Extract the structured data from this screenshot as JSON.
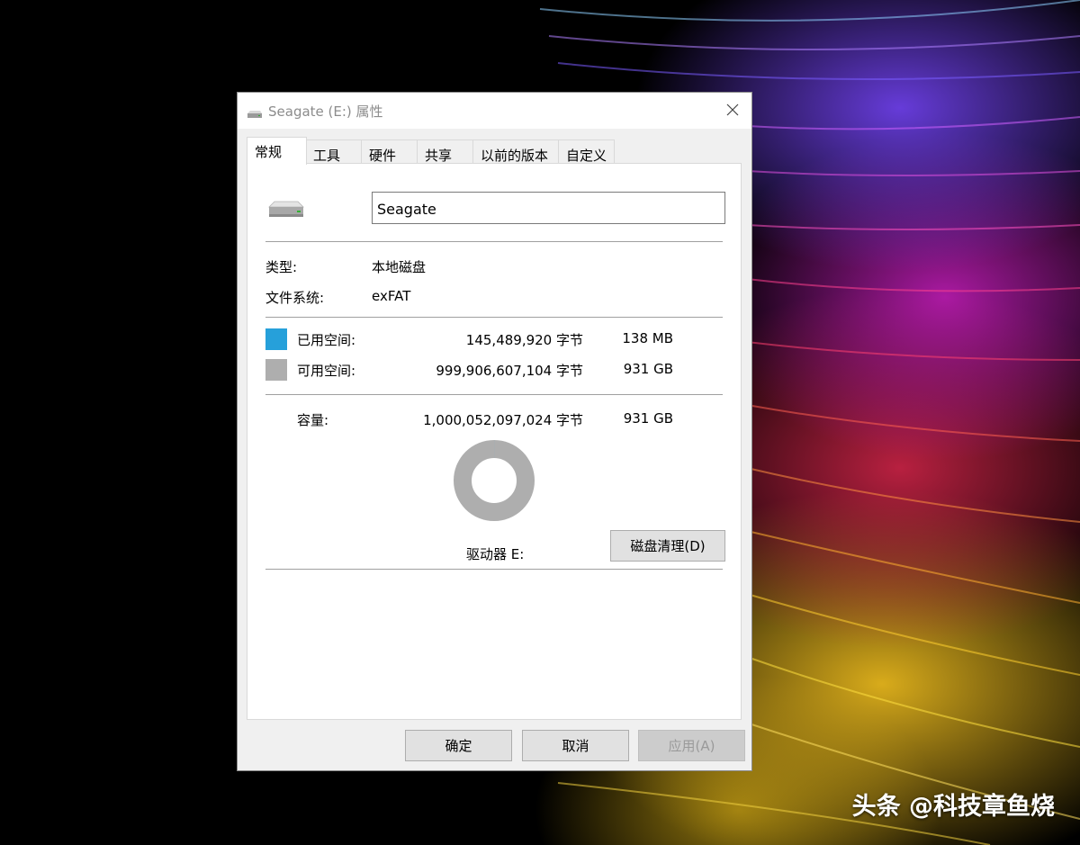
{
  "window": {
    "title": "Seagate (E:) 属性"
  },
  "tabs": [
    {
      "label": "常规",
      "active": true
    },
    {
      "label": "工具"
    },
    {
      "label": "硬件"
    },
    {
      "label": "共享"
    },
    {
      "label": "以前的版本"
    },
    {
      "label": "自定义"
    }
  ],
  "general": {
    "volume_name": "Seagate",
    "type_label": "类型:",
    "type_value": "本地磁盘",
    "fs_label": "文件系统:",
    "fs_value": "exFAT",
    "used": {
      "label": "已用空间:",
      "bytes": "145,489,920 字节",
      "size": "138 MB",
      "color": "#26a0da"
    },
    "free": {
      "label": "可用空间:",
      "bytes": "999,906,607,104 字节",
      "size": "931 GB",
      "color": "#aeaeae"
    },
    "capacity": {
      "label": "容量:",
      "bytes": "1,000,052,097,024 字节",
      "size": "931 GB"
    },
    "used_fraction": 0.000145,
    "drive_label": "驱动器 E:",
    "cleanup_button": "磁盘清理(D)"
  },
  "buttons": {
    "ok": "确定",
    "cancel": "取消",
    "apply": "应用(A)"
  },
  "watermark": "头条 @科技章鱼烧"
}
